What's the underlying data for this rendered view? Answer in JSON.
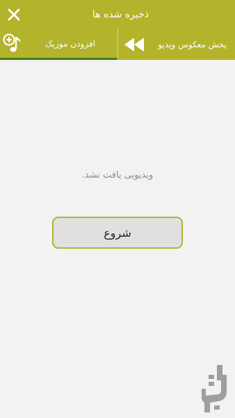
{
  "header": {
    "title": "ذخیره شده ها",
    "close_icon": "close-icon"
  },
  "tabs": [
    {
      "label": "پخش معکوس ویدیو",
      "icon": "rewind-icon"
    },
    {
      "label": "افزودن موزیک",
      "icon": "add-music-icon",
      "active": true
    }
  ],
  "main": {
    "empty_message": "ویدیویی یافت نشد.",
    "start_button_label": "شروع"
  },
  "colors": {
    "accent": "#b3b32c",
    "background": "#f2f2f2",
    "active_tab_underline": "#4a7a1c",
    "button_fill": "#e0e0e0"
  }
}
